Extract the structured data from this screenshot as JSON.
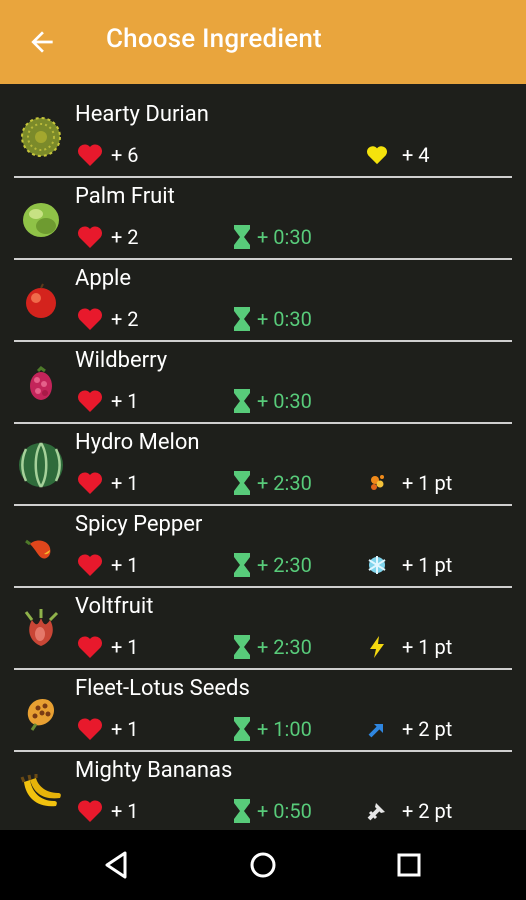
{
  "app_bar": {
    "title": "Choose Ingredient",
    "back_icon": "arrow-left-icon",
    "color": "#e9a53d"
  },
  "colors": {
    "background": "#1e1f1b",
    "heart": "#e8192c",
    "time": "#58cb7a",
    "divider": "#cfcfcf"
  },
  "ingredients": [
    {
      "name": "Hearty Durian",
      "icon": "durian-icon",
      "hearts": "+ 6",
      "time": "",
      "bonus_icon": "yellow-heart-icon",
      "bonus": "+ 4"
    },
    {
      "name": "Palm Fruit",
      "icon": "palm-fruit-icon",
      "hearts": "+ 2",
      "time": "+ 0:30",
      "bonus_icon": "",
      "bonus": ""
    },
    {
      "name": "Apple",
      "icon": "apple-icon",
      "hearts": "+ 2",
      "time": "+ 0:30",
      "bonus_icon": "",
      "bonus": ""
    },
    {
      "name": "Wildberry",
      "icon": "wildberry-icon",
      "hearts": "+ 1",
      "time": "+ 0:30",
      "bonus_icon": "",
      "bonus": ""
    },
    {
      "name": "Hydro Melon",
      "icon": "hydro-melon-icon",
      "hearts": "+ 1",
      "time": "+ 2:30",
      "bonus_icon": "heat-resistance-icon",
      "bonus": "+ 1 pt"
    },
    {
      "name": "Spicy Pepper",
      "icon": "spicy-pepper-icon",
      "hearts": "+ 1",
      "time": "+ 2:30",
      "bonus_icon": "cold-resistance-icon",
      "bonus": "+ 1 pt"
    },
    {
      "name": "Voltfruit",
      "icon": "voltfruit-icon",
      "hearts": "+ 1",
      "time": "+ 2:30",
      "bonus_icon": "shock-resistance-icon",
      "bonus": "+ 1 pt"
    },
    {
      "name": "Fleet-Lotus Seeds",
      "icon": "fleet-lotus-seeds-icon",
      "hearts": "+ 1",
      "time": "+ 1:00",
      "bonus_icon": "speed-icon",
      "bonus": "+ 2 pt"
    },
    {
      "name": "Mighty Bananas",
      "icon": "mighty-bananas-icon",
      "hearts": "+ 1",
      "time": "+ 0:50",
      "bonus_icon": "attack-up-icon",
      "bonus": "+ 2 pt"
    }
  ],
  "nav_bar": {
    "back_icon": "nav-back-icon",
    "home_icon": "nav-home-icon",
    "recents_icon": "nav-recents-icon"
  }
}
